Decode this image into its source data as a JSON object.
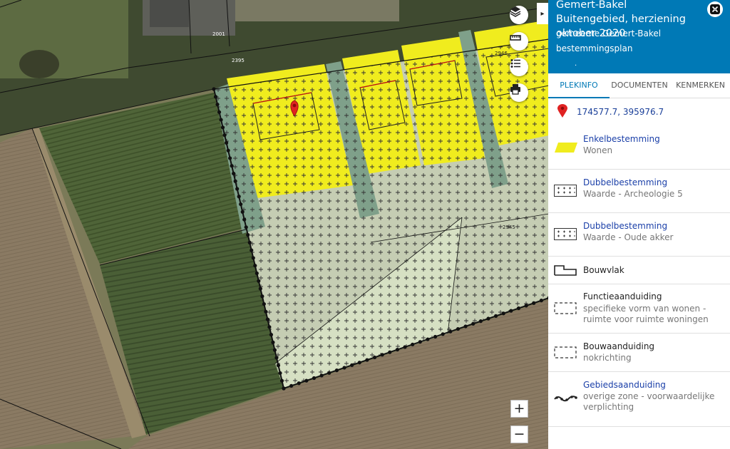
{
  "panel": {
    "title": "Gemert-Bakel Buitengebied, herziening oktober 2020",
    "municipality": "gemeente Gemert-Bakel",
    "plan_type": "bestemmingsplan",
    "dot": "."
  },
  "tabs": [
    "PLEKINFO",
    "DOCUMENTEN",
    "KENMERKEN"
  ],
  "coordinates": "174577.7, 395976.7",
  "legend": [
    {
      "title": "Enkelbestemming",
      "sub": "Wonen",
      "icon": "yellow-parallelogram-icon",
      "link": true
    },
    {
      "title": "Dubbelbestemming",
      "sub": "Waarde - Archeologie 5",
      "icon": "crosshatch-grid-icon",
      "link": true
    },
    {
      "title": "Dubbelbestemming",
      "sub": "Waarde - Oude akker",
      "icon": "crosshatch-grid-icon",
      "link": true
    },
    {
      "title": "Bouwvlak",
      "sub": "",
      "icon": "building-outline-icon",
      "link": false
    },
    {
      "title": "Functieaanduiding",
      "sub": "specifieke vorm van wonen - ruimte voor ruimte woningen",
      "icon": "dashed-box-icon",
      "link": false
    },
    {
      "title": "Bouwaanduiding",
      "sub": "nokrichting",
      "icon": "dashed-box-icon",
      "link": false
    },
    {
      "title": "Gebiedsaanduiding",
      "sub": "overige zone - voorwaardelijke verplichting",
      "icon": "chain-link-icon",
      "link": true
    }
  ],
  "map": {
    "parcel_labels": [
      "2001",
      "2395",
      "2946",
      "2945"
    ],
    "zoom_in": "+",
    "zoom_out": "−",
    "collapse": "▸",
    "colors": {
      "wonen": "#f0ec1e",
      "archeologie": "#7fa08a",
      "oude_akker": "#c9d3b6"
    }
  }
}
